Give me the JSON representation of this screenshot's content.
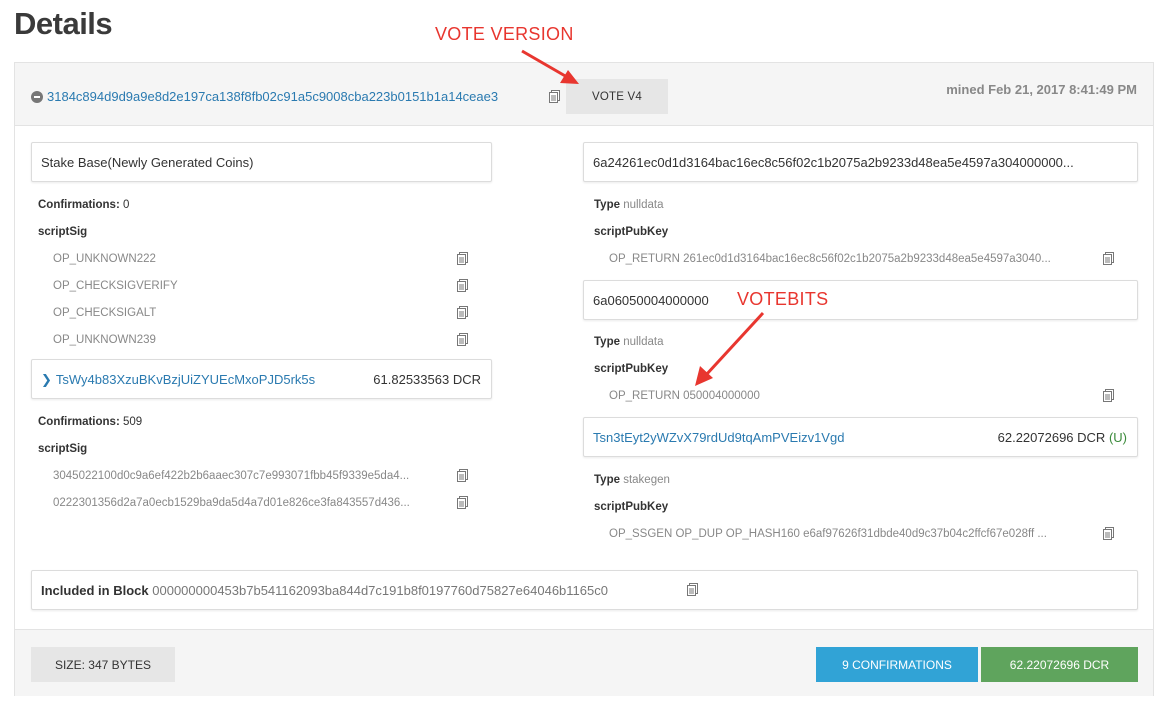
{
  "page_title": "Details",
  "tx": {
    "hash": "3184c894d9d9a9e8d2e197ca138f8fb02c91a5c9008cba223b0151b1a14ceae3",
    "vote_badge": "VOTE V4",
    "mined": "mined Feb 21, 2017 8:41:49 PM"
  },
  "annotations": {
    "vote_version": "VOTE VERSION",
    "votebits": "VOTEBITS",
    "color": "#e8362f"
  },
  "inputs": [
    {
      "title": "Stake Base(Newly Generated Coins)",
      "confirmations_label": "Confirmations:",
      "confirmations_value": "0",
      "script_label": "scriptSig",
      "script_lines": [
        "OP_UNKNOWN222",
        "OP_CHECKSIGVERIFY",
        "OP_CHECKSIGALT",
        "OP_UNKNOWN239"
      ]
    },
    {
      "address": "TsWy4b83XzuBKvBzjUiZYUEcMxoPJD5rk5s",
      "amount": "61.82533563 DCR",
      "confirmations_label": "Confirmations:",
      "confirmations_value": "509",
      "script_label": "scriptSig",
      "script_lines": [
        "3045022100d0c9a6ef422b2b6aaec307c7e993071fbb45f9339e5da4...",
        "0222301356d2a7a0ecb1529ba9da5d4a7d01e826ce3fa843557d436..."
      ]
    }
  ],
  "outputs": [
    {
      "header": "6a24261ec0d1d3164bac16ec8c56f02c1b2075a2b9233d48ea5e4597a304000000...",
      "type_label": "Type",
      "type_value": "nulldata",
      "script_label": "scriptPubKey",
      "script": "OP_RETURN 261ec0d1d3164bac16ec8c56f02c1b2075a2b9233d48ea5e4597a3040..."
    },
    {
      "header": "6a06050004000000",
      "type_label": "Type",
      "type_value": "nulldata",
      "script_label": "scriptPubKey",
      "script": "OP_RETURN 050004000000"
    },
    {
      "address": "Tsn3tEyt2yWZvX79rdUd9tqAmPVEizv1Vgd",
      "amount": "62.22072696 DCR",
      "unspent": "(U)",
      "type_label": "Type",
      "type_value": "stakegen",
      "script_label": "scriptPubKey",
      "script": "OP_SSGEN OP_DUP OP_HASH160 e6af97626f31dbde40d9c37b04c2ffcf67e028ff ..."
    }
  ],
  "block": {
    "label": "Included in Block",
    "hash": "000000000453b7b541162093ba844d7c191b8f0197760d75827e64046b1165c0"
  },
  "footer": {
    "size": "SIZE: 347 BYTES",
    "confirmations": "9 CONFIRMATIONS",
    "amount": "62.22072696 DCR"
  },
  "colors": {
    "link": "#2a7ab0",
    "confirmations_btn": "#31a3d6",
    "amount_btn": "#5fa45d",
    "unspent": "#3a8a3a"
  }
}
